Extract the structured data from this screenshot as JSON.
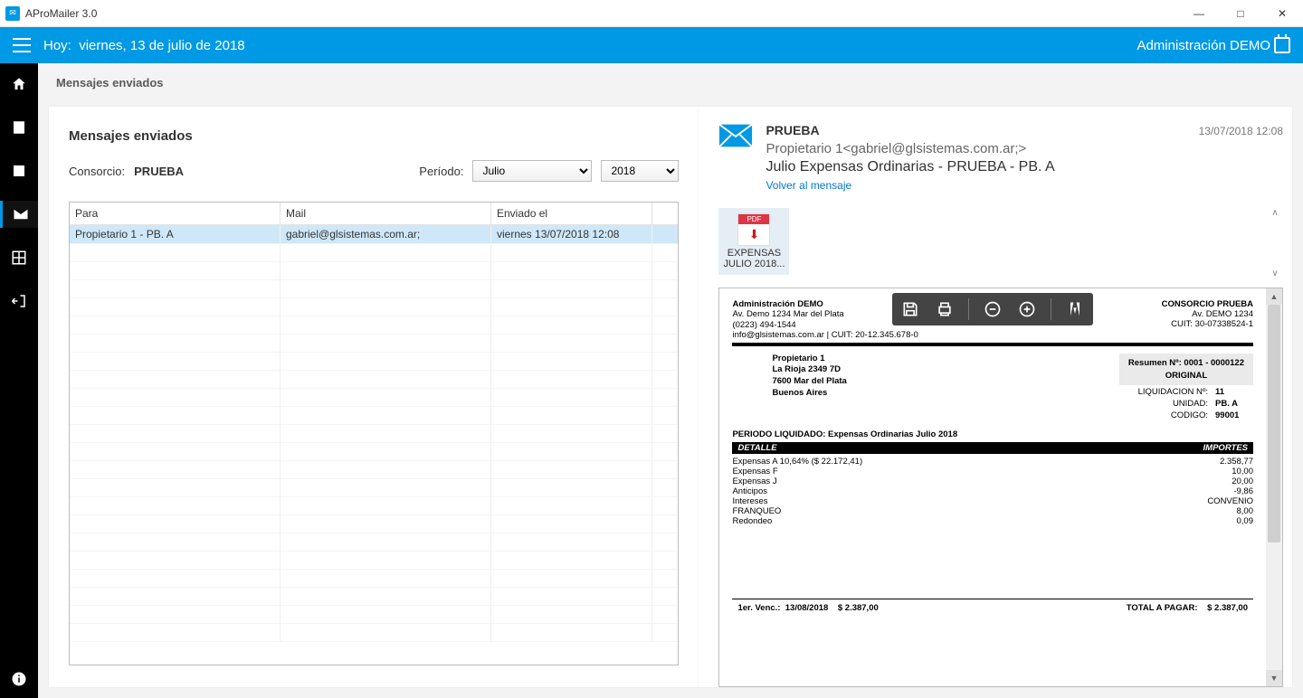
{
  "app_title": "AProMailer 3.0",
  "topbar": {
    "today_label": "Hoy:",
    "date": "viernes, 13 de julio de 2018",
    "admin_label": "Administración DEMO"
  },
  "sidebar_icons": {
    "home": "home",
    "building": "building",
    "contact": "contact",
    "mail": "mail",
    "module": "module",
    "exit": "exit",
    "info": "info"
  },
  "page_title": "Mensajes enviados",
  "left": {
    "title": "Mensajes enviados",
    "consorcio_lbl": "Consorcio:",
    "consorcio_val": "PRUEBA",
    "periodo_lbl": "Período:",
    "month_options": [
      "Julio"
    ],
    "month_selected": "Julio",
    "year_options": [
      "2018"
    ],
    "year_selected": "2018",
    "grid_headers": {
      "para": "Para",
      "mail": "Mail",
      "enviado": "Enviado el"
    },
    "rows": [
      {
        "para": "Propietario 1 - PB. A",
        "mail": "gabriel@glsistemas.com.ar;",
        "enviado": "viernes 13/07/2018 12:08"
      }
    ]
  },
  "right": {
    "consorcio": "PRUEBA",
    "datetime": "13/07/2018 12:08",
    "from": "Propietario 1<gabriel@glsistemas.com.ar;>",
    "subject": "Julio Expensas Ordinarias - PRUEBA - PB. A",
    "back_link": "Volver al mensaje",
    "attachment_name": "EXPENSAS JULIO 2018..."
  },
  "pdf": {
    "admin": {
      "name": "Administración DEMO",
      "addr": "Av. Demo 1234 Mar del Plata",
      "tel": "(0223) 494-1544",
      "email_cuit": "info@glsistemas.com.ar | CUIT: 20-12.345.678-0"
    },
    "consorcio": {
      "name": "CONSORCIO PRUEBA",
      "addr": "Av. DEMO 1234",
      "cuit": "CUIT: 30-07338524-1"
    },
    "destinatario": {
      "nombre": "Propietario 1",
      "dir1": "La Rioja 2349 7D",
      "dir2": "7600 Mar del Plata",
      "dir3": "Buenos Aires"
    },
    "resumen_num": "Resumen Nº: 0001 - 0000122",
    "original": "ORIGINAL",
    "liquidacion_lbl": "LIQUIDACION Nº:",
    "liquidacion_val": "11",
    "unidad_lbl": "UNIDAD:",
    "unidad_val": "PB. A",
    "codigo_lbl": "CODIGO:",
    "codigo_val": "99001",
    "periodo": "PERIODO LIQUIDADO: Expensas Ordinarias Julio 2018",
    "band_detalle": "DETALLE",
    "band_importes": "IMPORTES",
    "lines": [
      {
        "desc": "Expensas A 10,64% ($ 22.172,41)",
        "amt": "2.358,77"
      },
      {
        "desc": "Expensas F",
        "amt": "10,00"
      },
      {
        "desc": "Expensas J",
        "amt": "20,00"
      },
      {
        "desc": "Anticipos",
        "amt": "-9,86"
      },
      {
        "desc": "Intereses",
        "amt": "CONVENIO"
      },
      {
        "desc": "FRANQUEO",
        "amt": "8,00"
      },
      {
        "desc": "Redondeo",
        "amt": "0,09"
      }
    ],
    "venc_lbl": "1er. Venc.:",
    "venc_date": "13/08/2018",
    "venc_amt": "$ 2.387,00",
    "total_lbl": "TOTAL A PAGAR:",
    "total_amt": "$ 2.387,00"
  }
}
